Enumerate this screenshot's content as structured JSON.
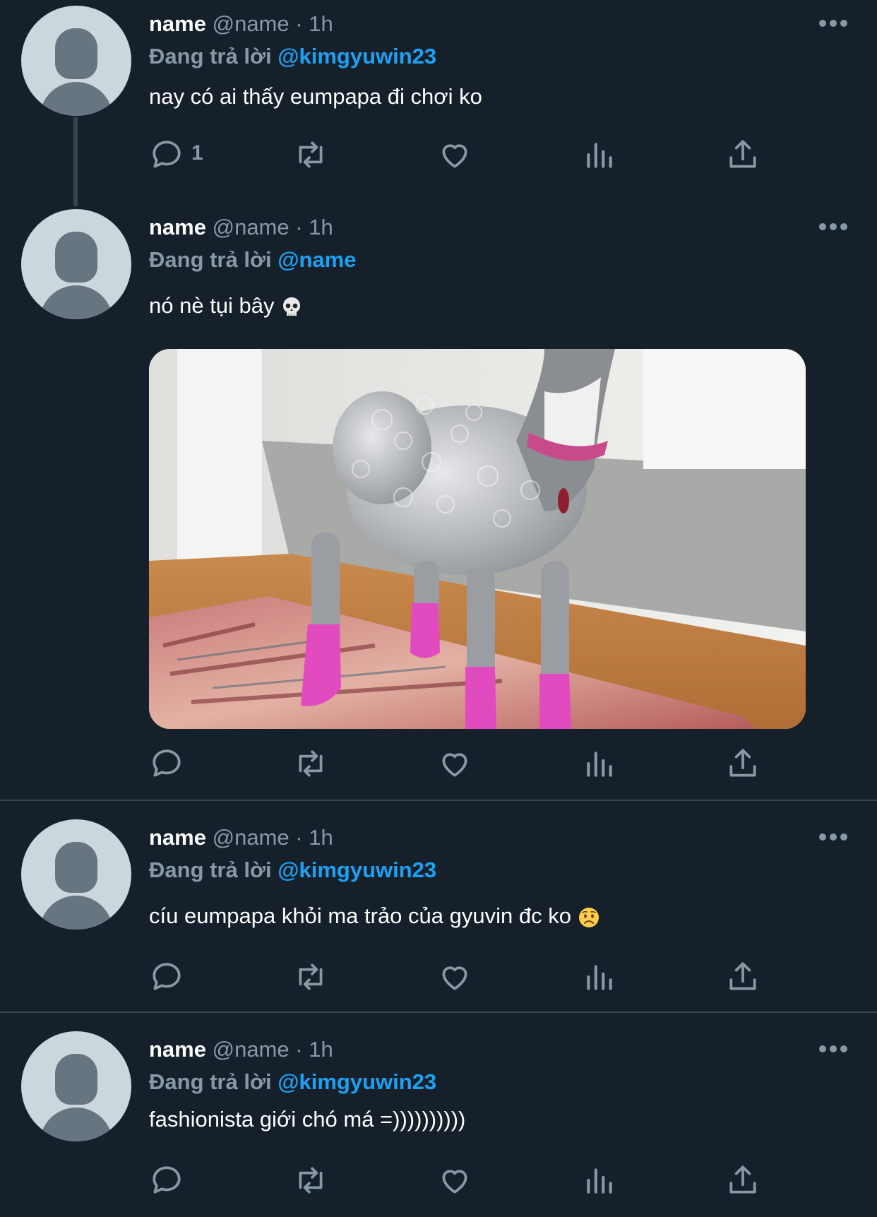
{
  "colors": {
    "background": "#15202b",
    "accent": "#1da1f2",
    "muted": "#8899a6",
    "divider": "#38444d"
  },
  "tweets": [
    {
      "name": "name",
      "handle": "@name",
      "dot": "·",
      "time": "1h",
      "reply_prefix": "Đang trả lời",
      "reply_to": "@kimgyuwin23",
      "text": "nay có ai thấy eumpapa đi chơi ko",
      "reply_count": "1"
    },
    {
      "name": "name",
      "handle": "@name",
      "dot": "·",
      "time": "1h",
      "reply_prefix": "Đang trả lời",
      "reply_to": "@name",
      "text": "nó nè tụi bây",
      "emoji": "skull-emoji",
      "media": "photo of a grey italian greyhound wrapped in bubble wrap with pink socks standing on a rug"
    },
    {
      "name": "name",
      "handle": "@name",
      "dot": "·",
      "time": "1h",
      "reply_prefix": "Đang trả lời",
      "reply_to": "@kimgyuwin23",
      "text": "cíu eumpapa khỏi ma trảo của gyuvin đc ko",
      "emoji": "worried-face-emoji"
    },
    {
      "name": "name",
      "handle": "@name",
      "dot": "·",
      "time": "1h",
      "reply_prefix": "Đang trả lời",
      "reply_to": "@kimgyuwin23",
      "text": "fashionista giới chó má =))))))))))"
    }
  ],
  "icons": [
    "reply-icon",
    "retweet-icon",
    "like-icon",
    "analytics-icon",
    "share-icon",
    "more-icon"
  ]
}
